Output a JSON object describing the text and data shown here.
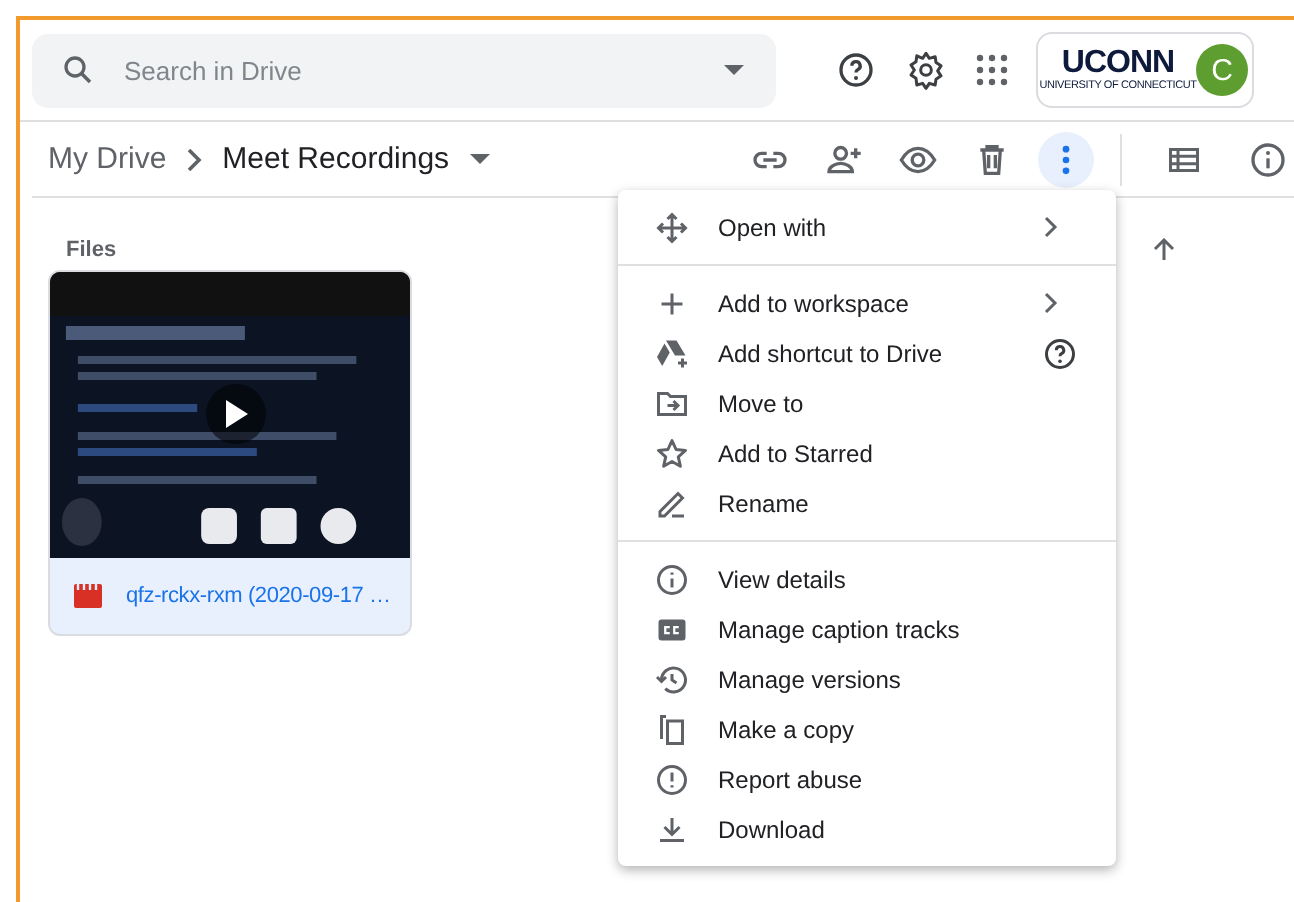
{
  "search": {
    "placeholder": "Search in Drive"
  },
  "org_logo": {
    "name": "UCONN",
    "subtitle": "UNIVERSITY OF CONNECTICUT"
  },
  "avatar": {
    "initial": "C",
    "color": "#5e9d2f"
  },
  "breadcrumbs": [
    {
      "label": "My Drive",
      "current": false
    },
    {
      "label": "Meet Recordings",
      "current": true
    }
  ],
  "toolbar": [
    {
      "kind": "link",
      "selected": false
    },
    {
      "kind": "share",
      "selected": false
    },
    {
      "kind": "preview",
      "selected": false
    },
    {
      "kind": "trash",
      "selected": false
    },
    {
      "kind": "more",
      "selected": true
    }
  ],
  "section_label": "Files",
  "files": [
    {
      "name": "qfz-rckx-rxm (2020-09-17 …"
    }
  ],
  "context_menu": [
    [
      {
        "label": "Open with",
        "kind": "move",
        "submenu": true,
        "help": false
      }
    ],
    [
      {
        "label": "Add to workspace",
        "kind": "plus",
        "submenu": true,
        "help": false
      },
      {
        "label": "Add shortcut to Drive",
        "kind": "drive",
        "submenu": false,
        "help": true
      },
      {
        "label": "Move to",
        "kind": "folder",
        "submenu": false,
        "help": false
      },
      {
        "label": "Add to Starred",
        "kind": "star",
        "submenu": false,
        "help": false
      },
      {
        "label": "Rename",
        "kind": "pencil",
        "submenu": false,
        "help": false
      }
    ],
    [
      {
        "label": "View details",
        "kind": "info",
        "submenu": false,
        "help": false
      },
      {
        "label": "Manage caption tracks",
        "kind": "cc",
        "submenu": false,
        "help": false
      },
      {
        "label": "Manage versions",
        "kind": "history",
        "submenu": false,
        "help": false
      },
      {
        "label": "Make a copy",
        "kind": "copy",
        "submenu": false,
        "help": false
      },
      {
        "label": "Report abuse",
        "kind": "alert",
        "submenu": false,
        "help": false
      },
      {
        "label": "Download",
        "kind": "download",
        "submenu": false,
        "help": false
      }
    ]
  ]
}
